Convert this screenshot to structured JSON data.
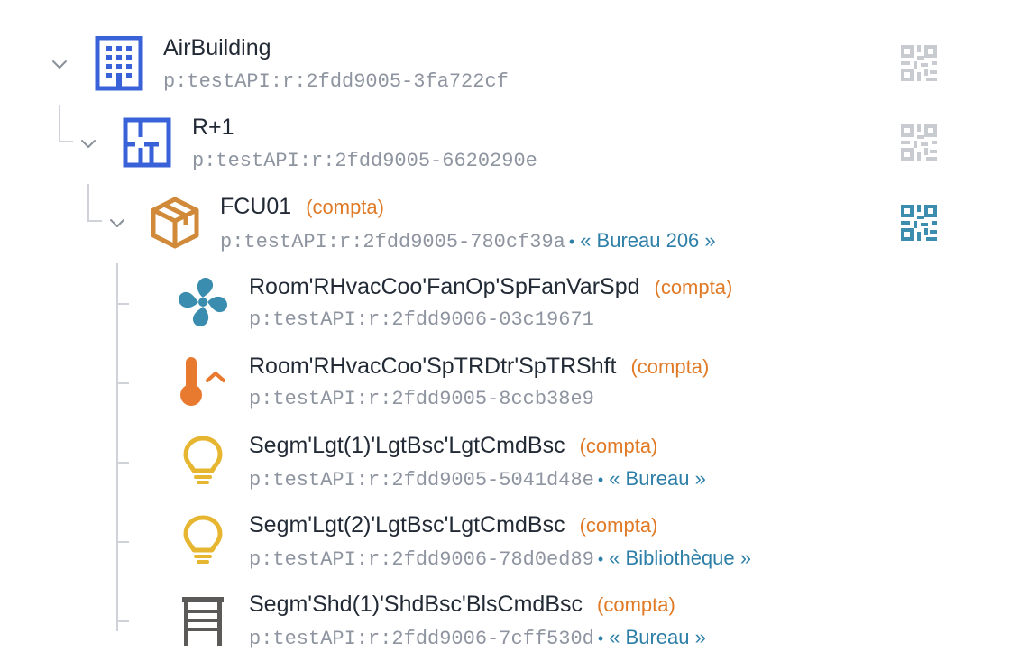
{
  "tree": {
    "nodes": [
      {
        "name": "AirBuilding",
        "ref": "p:testAPI:r:2fdd9005-3fa722cf"
      },
      {
        "name": "R+1",
        "ref": "p:testAPI:r:2fdd9005-6620290e"
      },
      {
        "name": "FCU01",
        "tag": "(compta)",
        "ref": "p:testAPI:r:2fdd9005-780cf39a",
        "location": "« Bureau 206 »"
      },
      {
        "name": "Room'RHvacCoo'FanOp'SpFanVarSpd",
        "tag": "(compta)",
        "ref": "p:testAPI:r:2fdd9006-03c19671"
      },
      {
        "name": "Room'RHvacCoo'SpTRDtr'SpTRShft",
        "tag": "(compta)",
        "ref": "p:testAPI:r:2fdd9005-8ccb38e9"
      },
      {
        "name": "Segm'Lgt(1)'LgtBsc'LgtCmdBsc",
        "tag": "(compta)",
        "ref": "p:testAPI:r:2fdd9005-5041d48e",
        "location": "« Bureau »"
      },
      {
        "name": "Segm'Lgt(2)'LgtBsc'LgtCmdBsc",
        "tag": "(compta)",
        "ref": "p:testAPI:r:2fdd9006-78d0ed89",
        "location": "« Bibliothèque »"
      },
      {
        "name": "Segm'Shd(1)'ShdBsc'BlsCmdBsc",
        "tag": "(compta)",
        "ref": "p:testAPI:r:2fdd9006-7cff530d",
        "location": "« Bureau »"
      }
    ]
  },
  "colors": {
    "building_blue": "#3a62d8",
    "equipment_orange": "#d08a3a",
    "fan_teal": "#3b8db0",
    "thermo_orange": "#e87a30",
    "bulb_yellow": "#e6b631",
    "shade_gray": "#5c5a58",
    "tag_orange": "#e07a26",
    "location_blue": "#2e7fa8",
    "qr_gray": "#c8ccd1",
    "qr_active": "#3d8eae"
  },
  "icons": [
    "chevron-down-icon",
    "building-icon",
    "floor-plan-icon",
    "package-icon",
    "fan-icon",
    "thermometer-icon",
    "lightbulb-icon",
    "blinds-icon",
    "qr-code-icon"
  ]
}
